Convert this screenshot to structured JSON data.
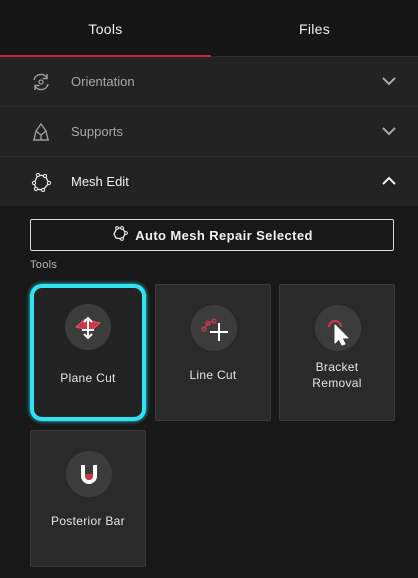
{
  "tabs": [
    {
      "label": "Tools",
      "active": true
    },
    {
      "label": "Files",
      "active": false
    }
  ],
  "accordions": [
    {
      "label": "Orientation",
      "icon": "rotate-icon",
      "expanded": false
    },
    {
      "label": "Supports",
      "icon": "supports-icon",
      "expanded": false
    },
    {
      "label": "Mesh Edit",
      "icon": "mesh-icon",
      "expanded": true
    }
  ],
  "mesh_edit": {
    "repair_button_label": "Auto Mesh Repair Selected",
    "tools_label": "Tools",
    "tools": [
      {
        "label": "Plane Cut",
        "icon": "plane-cut-icon",
        "selected": true
      },
      {
        "label": "Line Cut",
        "icon": "line-cut-icon",
        "selected": false
      },
      {
        "label": "Bracket Removal",
        "icon": "bracket-removal-icon",
        "selected": false
      },
      {
        "label": "Posterior Bar",
        "icon": "posterior-bar-icon",
        "selected": false
      }
    ]
  },
  "colors": {
    "accent_red": "#c4283a",
    "selection_cyan": "#2fe3ef",
    "background": "#151515"
  }
}
